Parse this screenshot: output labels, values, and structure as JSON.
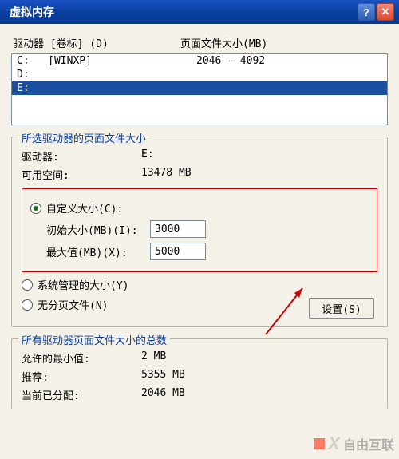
{
  "title": "虚拟内存",
  "list_header": {
    "drive": "驱动器 [卷标] (D)",
    "pagefile": "页面文件大小(MB)"
  },
  "drives": [
    {
      "label": "C:   [WINXP]",
      "size": "2046 - 4092",
      "selected": false
    },
    {
      "label": "D:",
      "size": "",
      "selected": false
    },
    {
      "label": "E:",
      "size": "",
      "selected": true
    }
  ],
  "selected_group": {
    "legend": "所选驱动器的页面文件大小",
    "drive_label": "驱动器:",
    "drive_value": "E:",
    "space_label": "可用空间:",
    "space_value": "13478 MB",
    "custom_label": "自定义大小(C):",
    "initial_label": "初始大小(MB)(I):",
    "initial_value": "3000",
    "max_label": "最大值(MB)(X):",
    "max_value": "5000",
    "system_label": "系统管理的大小(Y)",
    "none_label": "无分页文件(N)",
    "set_button": "设置(S)"
  },
  "totals_group": {
    "legend": "所有驱动器页面文件大小的总数",
    "min_label": "允许的最小值:",
    "min_value": "2 MB",
    "rec_label": "推荐:",
    "rec_value": "5355 MB",
    "cur_label": "当前已分配:",
    "cur_value": "2046 MB"
  },
  "watermark": "自由互联"
}
